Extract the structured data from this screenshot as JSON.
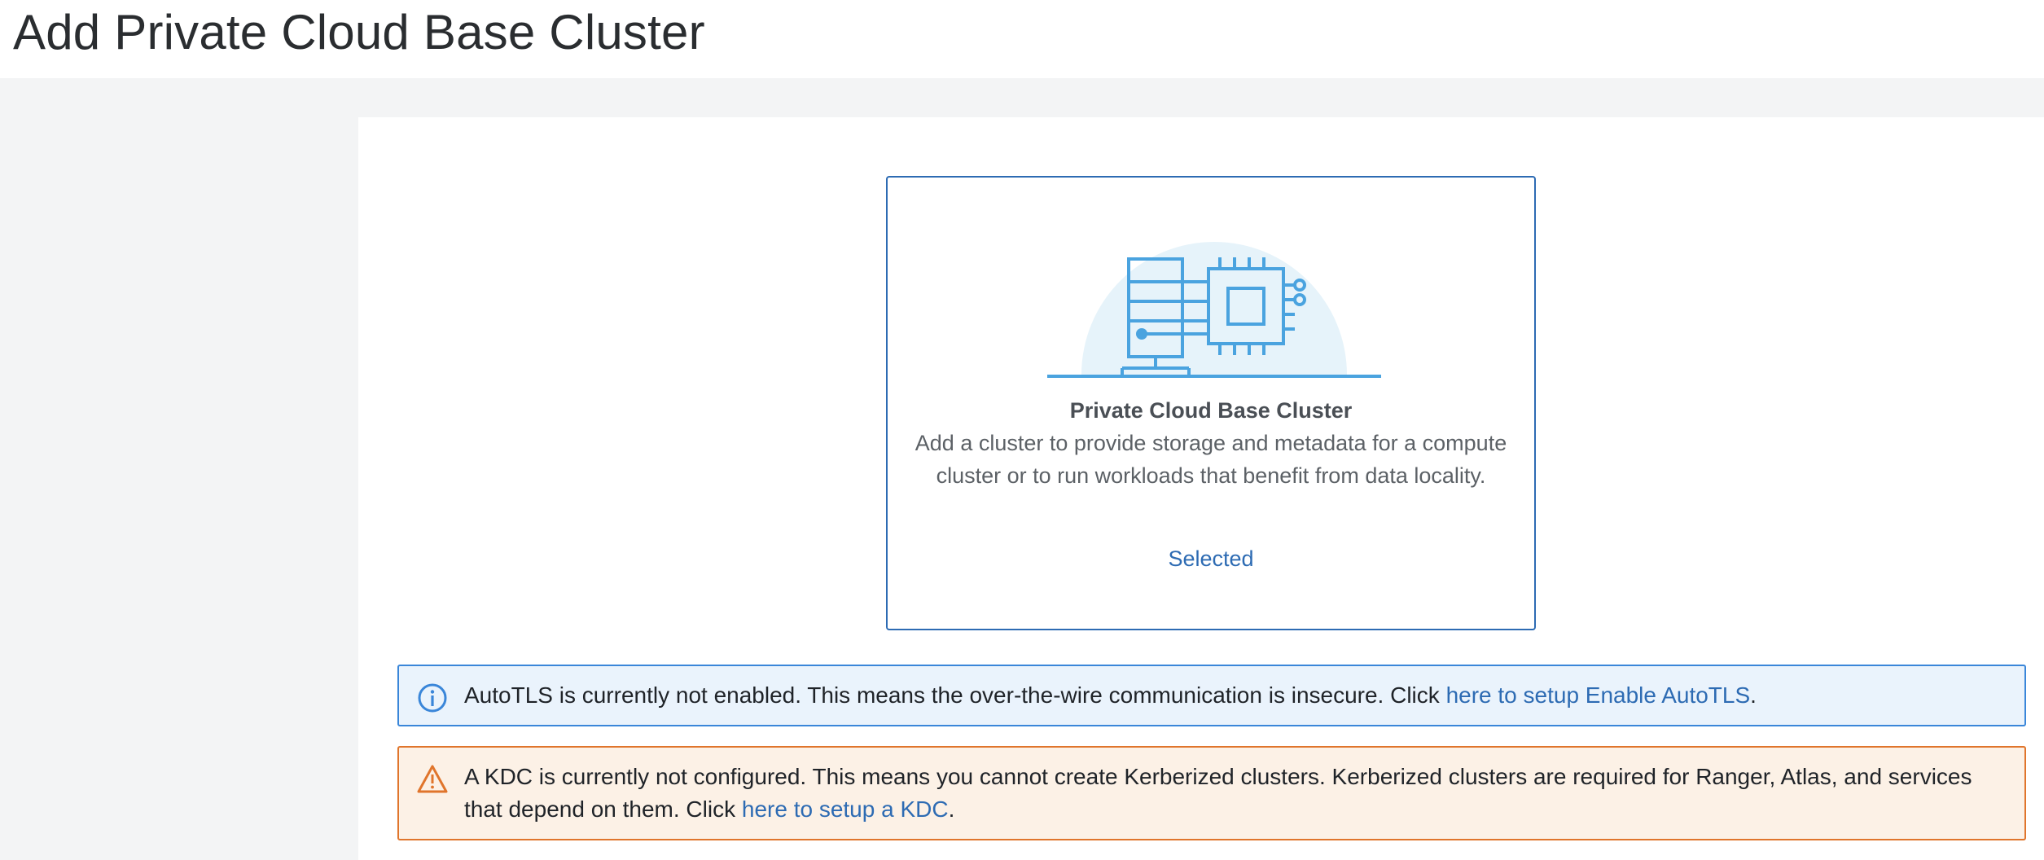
{
  "page": {
    "title": "Add Private Cloud Base Cluster"
  },
  "card": {
    "title": "Private Cloud Base Cluster",
    "description": "Add a cluster to provide storage and metadata for a compute cluster or to run workloads that benefit from data locality.",
    "status": "Selected",
    "illustration_icon": "server-and-chip-icon"
  },
  "alerts": {
    "autotls": {
      "icon": "info-circle-icon",
      "text": "AutoTLS is currently not enabled. This means the over-the-wire communication is insecure. Click ",
      "link_text": "here to setup Enable AutoTLS",
      "suffix": "."
    },
    "kdc": {
      "icon": "warning-triangle-icon",
      "text": "A KDC is currently not configured. This means you cannot create Kerberized clusters. Kerberized clusters are required for Ranger, Atlas, and services that depend on them. Click ",
      "link_text": "here to setup a KDC",
      "suffix": "."
    }
  },
  "colors": {
    "accent": "#2d6bb3",
    "info_border": "#3a86d9",
    "info_bg": "#eaf3fc",
    "warn_border": "#e0752c",
    "warn_bg": "#fcf1e6",
    "illustration": "#4aa3df",
    "illustration_bg": "#e6f3fa"
  }
}
